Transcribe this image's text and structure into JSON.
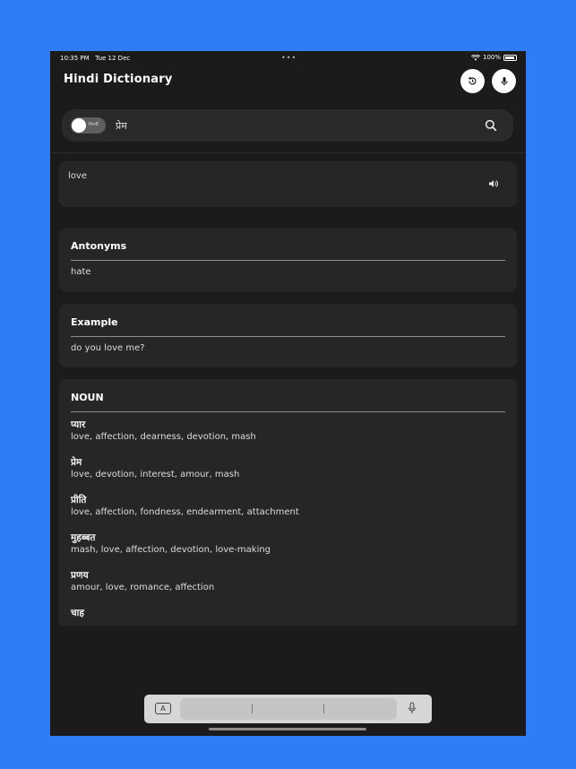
{
  "status": {
    "time": "10:35 PM",
    "date": "Tue 12 Dec",
    "battery": "100%"
  },
  "app": {
    "title": "Hindi Dictionary"
  },
  "search": {
    "toggle_label": "H↔E",
    "query": "प्रेम"
  },
  "meaning": {
    "text": "love"
  },
  "antonyms": {
    "title": "Antonyms",
    "text": "hate"
  },
  "example": {
    "title": "Example",
    "text": "do you love me?"
  },
  "noun": {
    "title": "NOUN",
    "entries": [
      {
        "word": "प्यार",
        "synonyms": "love, affection, dearness, devotion, mash"
      },
      {
        "word": "प्रेम",
        "synonyms": "love, devotion, interest, amour, mash"
      },
      {
        "word": "प्रीति",
        "synonyms": "love, affection, fondness, endearment, attachment"
      },
      {
        "word": "मुहब्बत",
        "synonyms": "mash, love, affection, devotion, love-making"
      },
      {
        "word": "प्रणय",
        "synonyms": "amour, love, romance, affection"
      },
      {
        "word": "चाह",
        "synonyms": ""
      }
    ]
  },
  "keyboard": {
    "key_label": "A"
  },
  "colors": {
    "background": "#2f7cf6",
    "screen": "#1b1b1b",
    "card": "#262626"
  }
}
